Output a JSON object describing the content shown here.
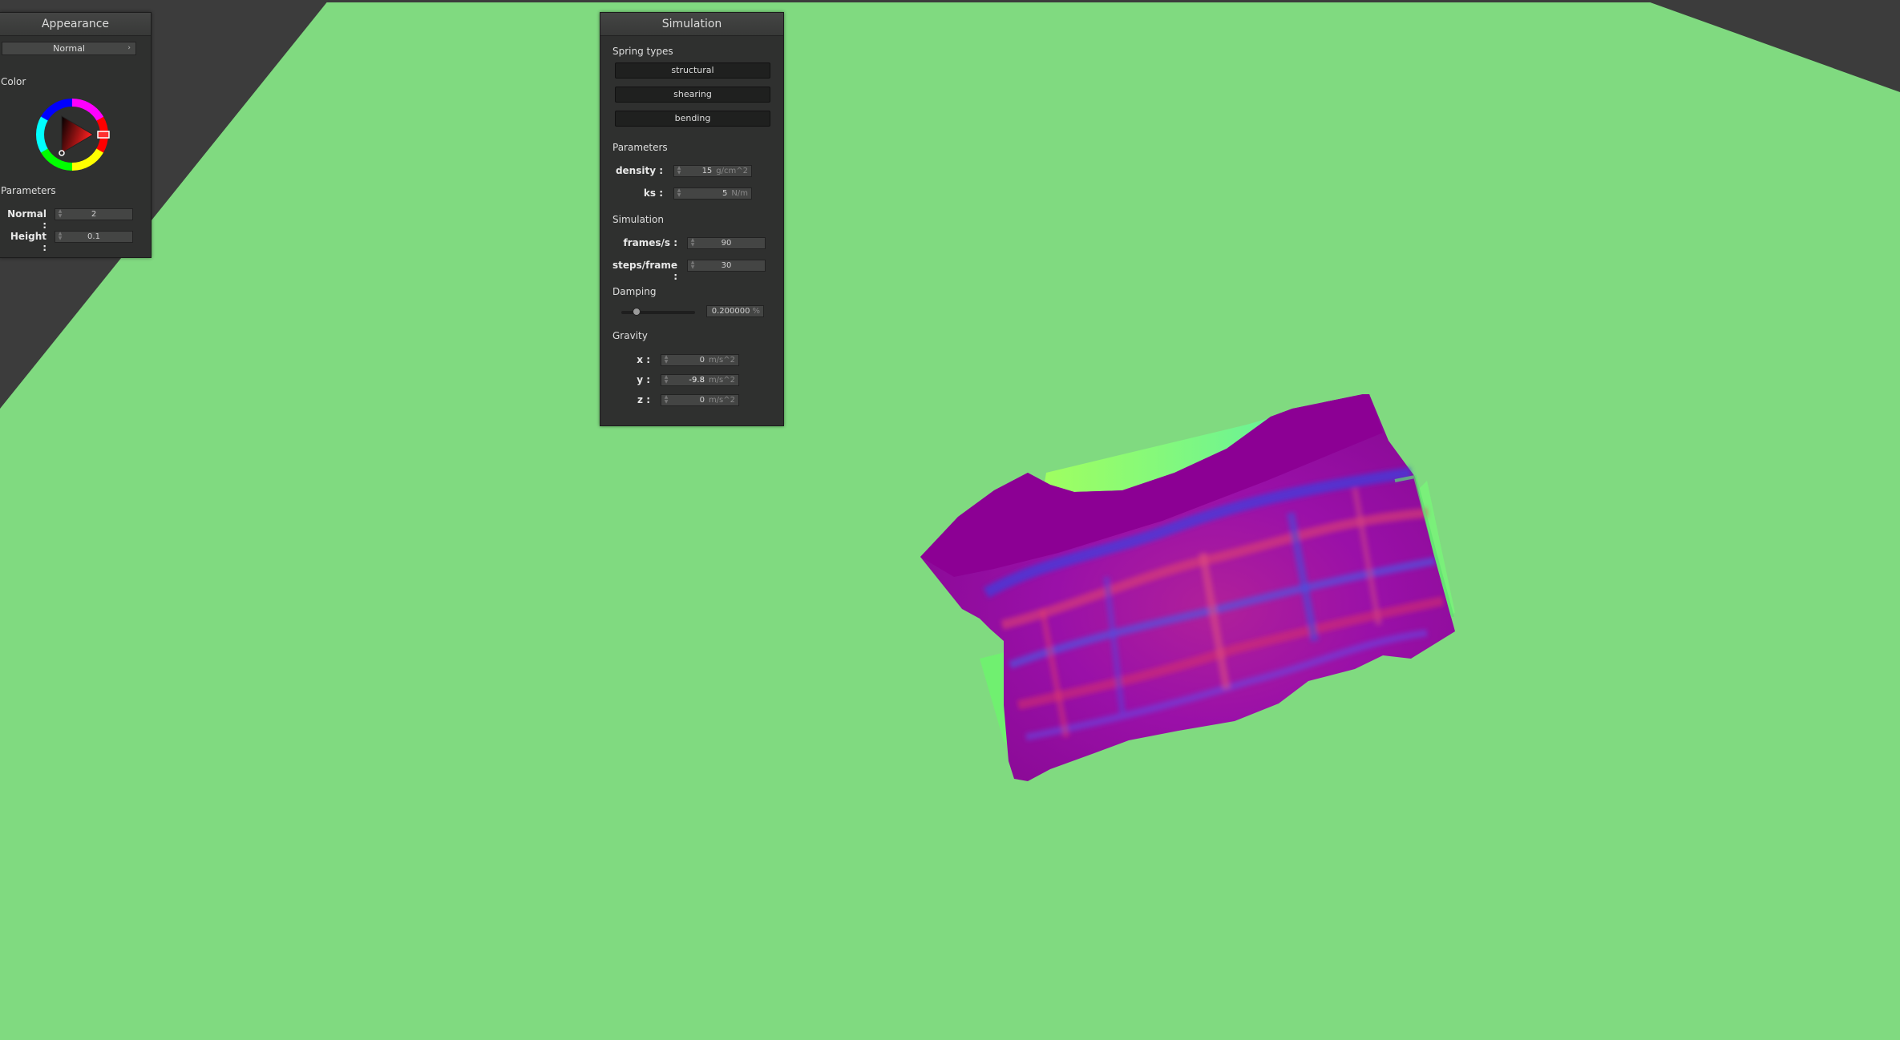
{
  "scene": {
    "background_color": "#80da80",
    "corner_shade_color": "#3c3c3c",
    "cloth_base_color": "#8a0a96"
  },
  "appearance_panel": {
    "title": "Appearance",
    "mode_select": {
      "value": "Normal",
      "chevron_icon": "chevron-right-icon"
    },
    "color_section_label": "Color",
    "color_picker": {
      "selected_hue_color": "#ff2020",
      "icon": "color-wheel-icon"
    },
    "parameters_label": "Parameters",
    "fields": [
      {
        "label": "Normal :",
        "value": "2"
      },
      {
        "label": "Height :",
        "value": "0.1"
      }
    ]
  },
  "simulation_panel": {
    "title": "Simulation",
    "spring_types_label": "Spring types",
    "spring_buttons": [
      "structural",
      "shearing",
      "bending"
    ],
    "parameters_label": "Parameters",
    "parameters": [
      {
        "label": "density :",
        "value": "15",
        "unit": "g/cm^2"
      },
      {
        "label": "ks :",
        "value": "5",
        "unit": "N/m"
      }
    ],
    "simulation_label": "Simulation",
    "simulation_fields": [
      {
        "label": "frames/s :",
        "value": "90"
      },
      {
        "label": "steps/frame :",
        "value": "30"
      }
    ],
    "damping_label": "Damping",
    "damping": {
      "value": "0.200000",
      "unit": "%",
      "slider_level": 0.2
    },
    "gravity_label": "Gravity",
    "gravity": [
      {
        "label": "x :",
        "value": "0",
        "unit": "m/s^2"
      },
      {
        "label": "y :",
        "value": "-9.8",
        "unit": "m/s^2"
      },
      {
        "label": "z :",
        "value": "0",
        "unit": "m/s^2"
      }
    ]
  }
}
